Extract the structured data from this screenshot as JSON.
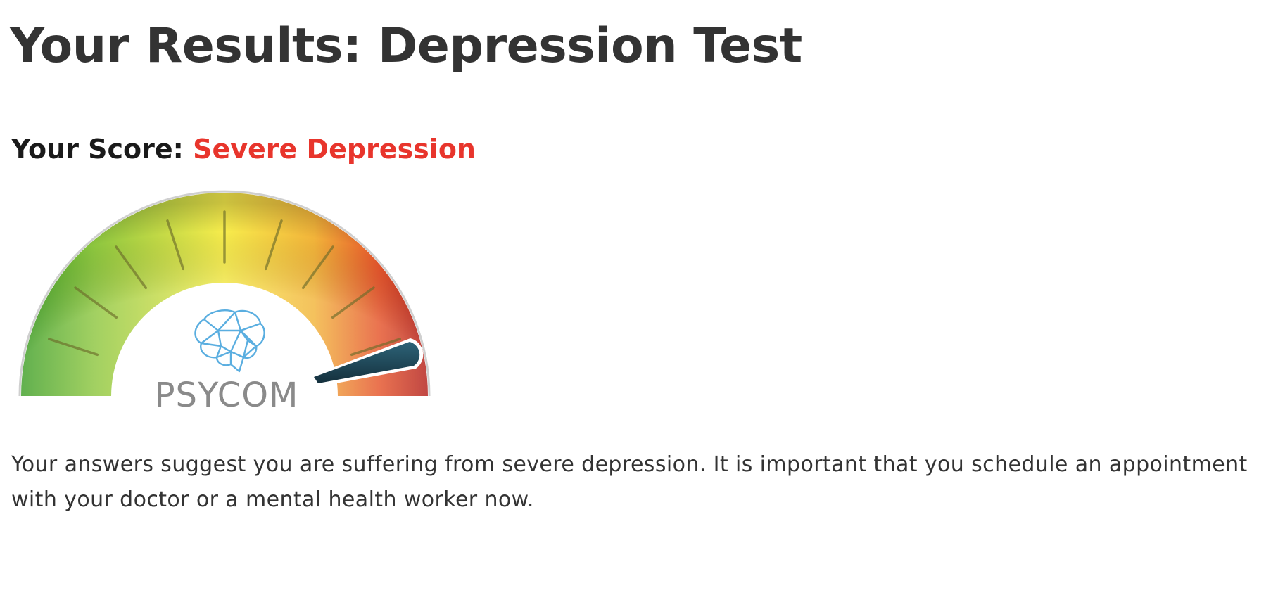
{
  "title": "Your Results: Depression Test",
  "score": {
    "label": "Your Score:",
    "value": "Severe Depression",
    "value_color": "#e8352c"
  },
  "gauge": {
    "logo_text": "PSYCOM",
    "logo_icon": "brain-icon",
    "needle_level": "severe",
    "colors": [
      "#4aa82e",
      "#8dc63f",
      "#f5ea4a",
      "#f0a030",
      "#e23a22",
      "#b21f1a"
    ],
    "needle_color": "#1f4a5e"
  },
  "result": {
    "message": "Your answers suggest you are suffering from severe depression. It is important that you schedule an appointment with your doctor or a mental health worker now."
  }
}
